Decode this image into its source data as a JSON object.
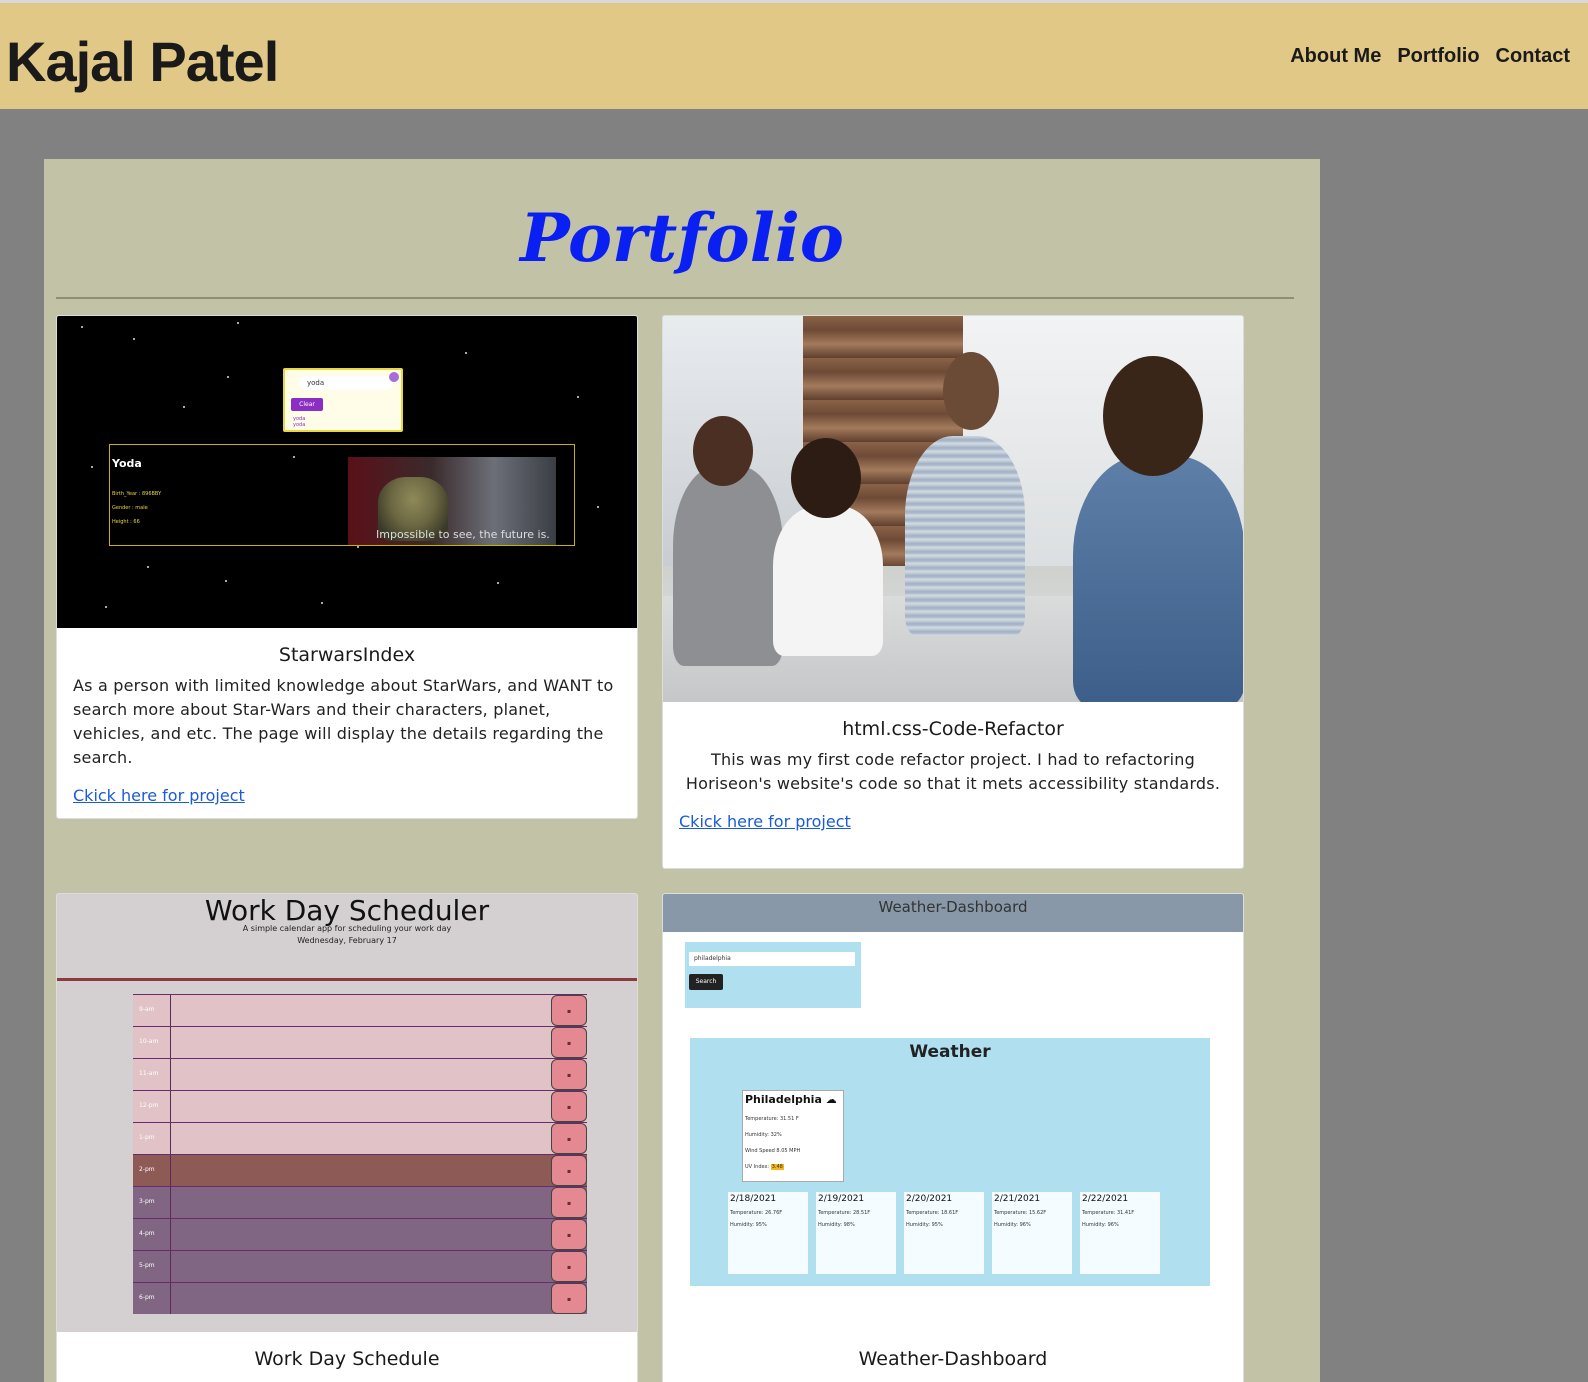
{
  "header": {
    "brand": "Kajal Patel",
    "nav": [
      "About Me",
      "Portfolio",
      "Contact"
    ]
  },
  "portfolio": {
    "title": "Portfolio",
    "cards": [
      {
        "title": "StarwarsIndex",
        "text": "As a person with limited knowledge about StarWars, and WANT to search more about Star-Wars and their characters, planet, vehicles, and etc. The page will display the details regarding the search.",
        "link": "Ckick here for project",
        "screenshot": {
          "search_value": "yoda",
          "clear_label": "Clear",
          "history": [
            "yoda",
            "yoda"
          ],
          "name": "Yoda",
          "details": [
            "Birth_Year : 896BBY",
            "Gender : male",
            "Height : 66"
          ],
          "caption": "Impossible to see, the future is."
        }
      },
      {
        "title": "html.css-Code-Refactor",
        "text": "This was my first code refactor project. I had to refactoring Horiseon's website's code so that it mets accessibility standards.",
        "link": "Ckick here for project"
      },
      {
        "title": "Work Day Schedule",
        "screenshot": {
          "title": "Work Day Scheduler",
          "subtitle": "A simple calendar app for scheduling your work day",
          "date": "Wednesday, February 17",
          "hours": [
            "9-am",
            "10-am",
            "11-am",
            "12-pm",
            "1-pm",
            "2-pm",
            "3-pm",
            "4-pm",
            "5-pm",
            "6-pm"
          ],
          "save_icon": "lock-icon"
        }
      },
      {
        "title": "Weather-Dashboard",
        "screenshot": {
          "bar_title": "Weather-Dashboard",
          "search_value": "philadelphia",
          "search_button": "Search",
          "heading": "Weather",
          "city": "Philadelphia",
          "temperature": "Temperature: 31.51 F",
          "humidity": "Humidity: 32%",
          "wind": "Wind Speed 8.05 MPH",
          "uv_label": "UV Index:",
          "uv_value": "3.48",
          "forecast": [
            {
              "date": "2/18/2021",
              "temp": "Temperature: 26.76F",
              "hum": "Humidity: 95%"
            },
            {
              "date": "2/19/2021",
              "temp": "Temperature: 28.51F",
              "hum": "Humidity: 98%"
            },
            {
              "date": "2/20/2021",
              "temp": "Temperature: 18.61F",
              "hum": "Humidity: 95%"
            },
            {
              "date": "2/21/2021",
              "temp": "Temperature: 15.62F",
              "hum": "Humidity: 96%"
            },
            {
              "date": "2/22/2021",
              "temp": "Temperature: 31.41F",
              "hum": "Humidity: 96%"
            }
          ]
        }
      }
    ]
  },
  "colors": {
    "header_bg": "#e1c887",
    "page_bg": "#818181",
    "panel_bg": "#c2c3a6",
    "title": "#0a1ff2",
    "link": "#1a5bd8"
  }
}
